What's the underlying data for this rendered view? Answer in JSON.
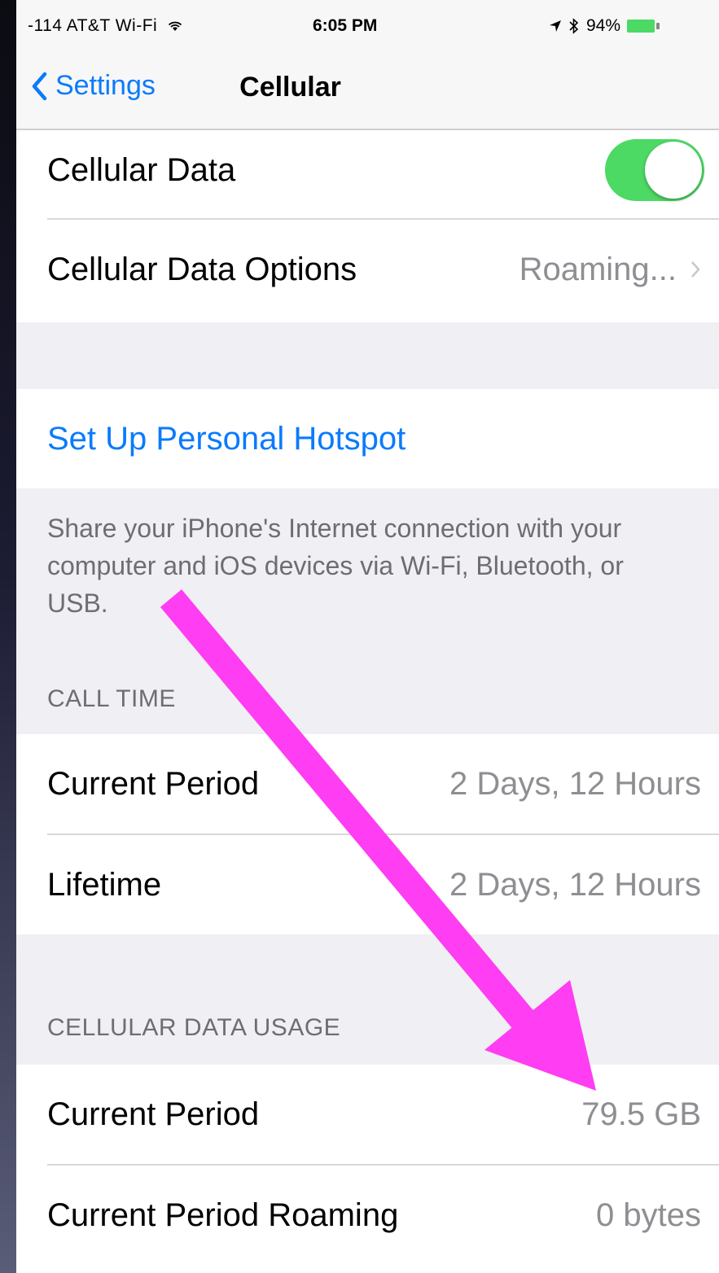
{
  "status_bar": {
    "carrier": "-114 AT&T Wi-Fi",
    "time": "6:05 PM",
    "battery": "94%"
  },
  "nav": {
    "back_label": "Settings",
    "title": "Cellular"
  },
  "cellular": {
    "cellular_data_label": "Cellular Data",
    "cellular_data_on": true,
    "options_label": "Cellular Data Options",
    "options_value": "Roaming..."
  },
  "hotspot": {
    "link_label": "Set Up Personal Hotspot",
    "footer": "Share your iPhone's Internet connection with your computer and iOS devices via Wi-Fi, Bluetooth, or USB."
  },
  "call_time": {
    "header": "CALL TIME",
    "rows": [
      {
        "label": "Current Period",
        "value": "2 Days, 12 Hours"
      },
      {
        "label": "Lifetime",
        "value": "2 Days, 12 Hours"
      }
    ]
  },
  "data_usage": {
    "header": "CELLULAR DATA USAGE",
    "rows": [
      {
        "label": "Current Period",
        "value": "79.5 GB"
      },
      {
        "label": "Current Period Roaming",
        "value": "0 bytes"
      }
    ]
  },
  "colors": {
    "ios_blue": "#0a7bfc",
    "toggle_green": "#4cd964",
    "annotation_arrow": "#ff3df2"
  },
  "icons": {
    "back": "chevron-left-icon",
    "disclosure": "chevron-right-icon",
    "wifi": "wifi-icon",
    "location": "location-arrow-icon",
    "bluetooth": "bluetooth-icon",
    "battery": "battery-icon"
  }
}
